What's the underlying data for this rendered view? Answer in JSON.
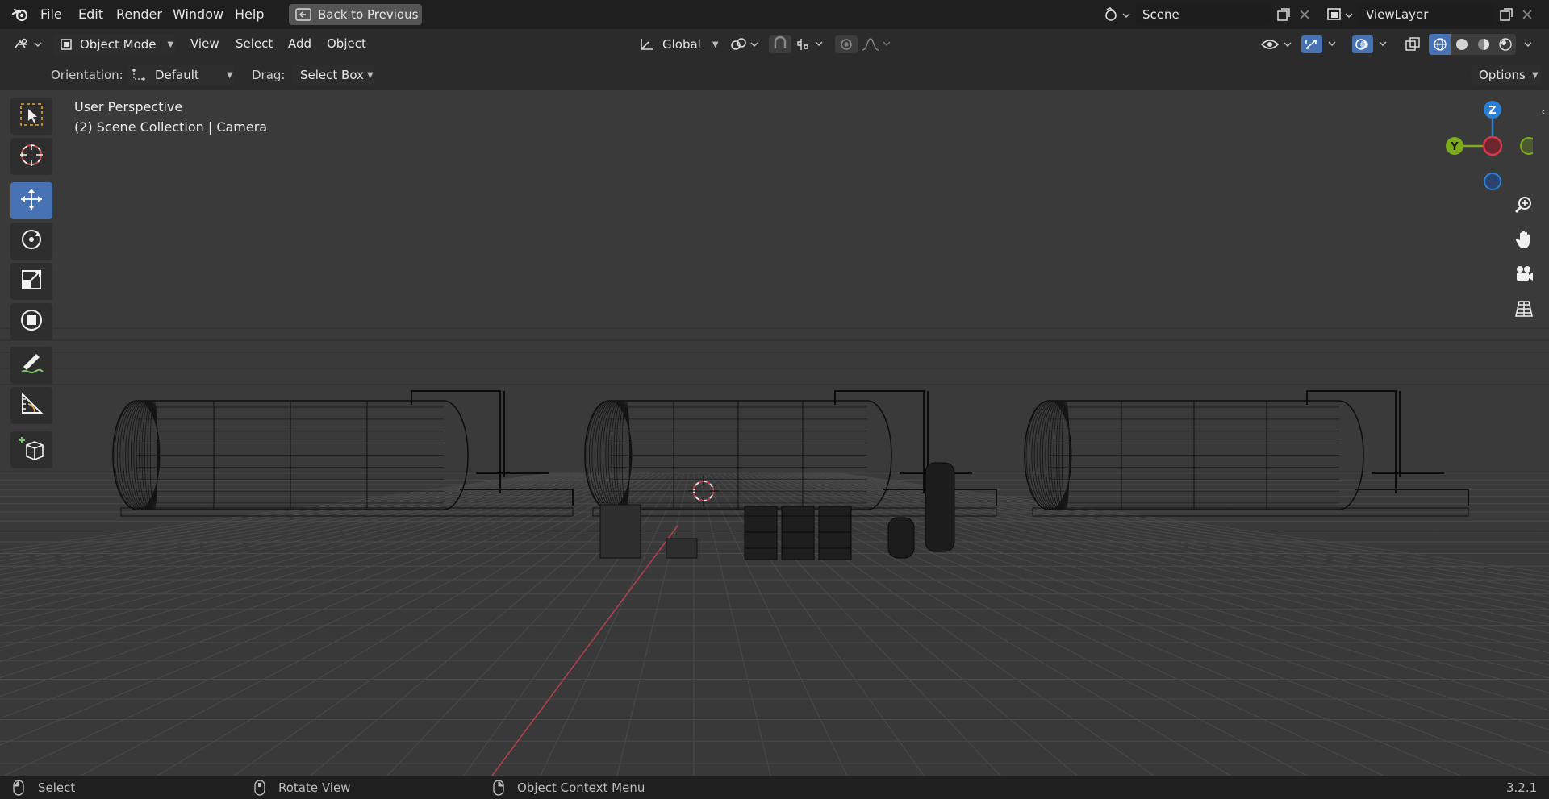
{
  "topbar": {
    "menus": [
      "File",
      "Edit",
      "Render",
      "Window",
      "Help"
    ],
    "back_button": "Back to Previous",
    "scene_label": "Scene",
    "viewlayer_label": "ViewLayer"
  },
  "header": {
    "mode": "Object Mode",
    "menus": [
      "View",
      "Select",
      "Add",
      "Object"
    ],
    "transform_orientation": "Global",
    "options": "Options"
  },
  "toolsettings": {
    "orientation_label": "Orientation:",
    "orientation_value": "Default",
    "drag_label": "Drag:",
    "drag_value": "Select Box"
  },
  "viewport": {
    "view_name": "User Perspective",
    "collection": "(2) Scene Collection | Camera",
    "gizmo_axes": {
      "z": "Z",
      "y": "Y"
    },
    "colors": {
      "x": "#d6394b",
      "y": "#7dac1e",
      "z": "#2c7fd6",
      "active_tool": "#4772b3"
    }
  },
  "status": {
    "select": "Select",
    "rotate": "Rotate View",
    "context": "Object Context Menu",
    "version": "3.2.1"
  },
  "icons": [
    "blender-logo",
    "back-icon",
    "scene-icon",
    "viewlayer-icon",
    "copy-icon",
    "close-icon",
    "editor-type-icon",
    "object-mode-icon",
    "transform-icon",
    "pivot-icon",
    "snap-icon",
    "proportional-icon",
    "visibility-icon",
    "gizmo-icon",
    "overlay-icon",
    "xray-icon",
    "wireframe-shading-icon",
    "solid-shading-icon",
    "material-shading-icon",
    "rendered-shading-icon",
    "select-box-tool-icon",
    "cursor-tool-icon",
    "move-tool-icon",
    "rotate-tool-icon",
    "scale-tool-icon",
    "transform-tool-icon",
    "annotate-tool-icon",
    "measure-tool-icon",
    "add-cube-tool-icon",
    "zoom-icon",
    "hand-icon",
    "camera-icon",
    "grid-icon",
    "mouse-icon"
  ]
}
